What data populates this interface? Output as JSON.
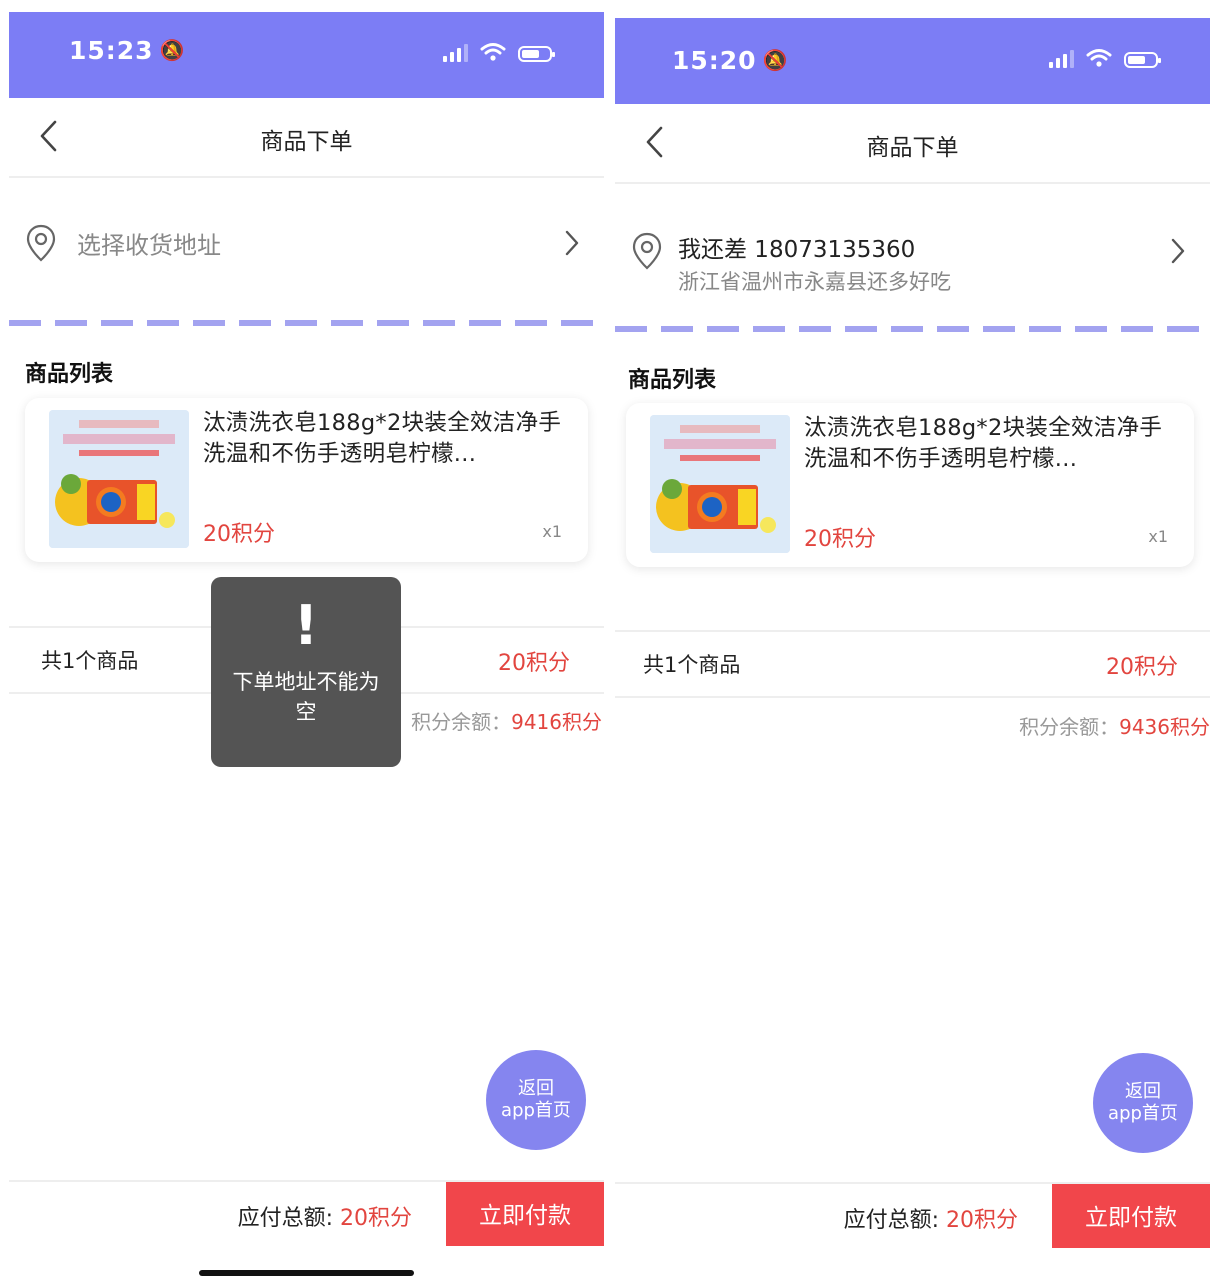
{
  "colors": {
    "accent": "#7c7df5",
    "price": "#e2453f",
    "pay_button": "#f1464b",
    "toast_bg": "#545454"
  },
  "left": {
    "status": {
      "time": "15:23"
    },
    "nav": {
      "title": "商品下单"
    },
    "address": {
      "placeholder": "选择收货地址"
    },
    "section_title": "商品列表",
    "product": {
      "title": "汰渍洗衣皂188g*2块装全效洁净手洗温和不伤手透明皂柠檬...",
      "price": "20积分",
      "qty": "x1"
    },
    "summary": {
      "count": "共1个商品",
      "total": "20积分"
    },
    "balance": {
      "label": "积分余额：",
      "value": "9416积分"
    },
    "home_button": {
      "line1": "返回",
      "line2": "app首页"
    },
    "footer": {
      "total_label": "应付总额: ",
      "total_value": "20积分",
      "pay_label": "立即付款"
    },
    "toast": {
      "icon": "!",
      "message": "下单地址不能为空"
    }
  },
  "right": {
    "status": {
      "time": "15:20"
    },
    "nav": {
      "title": "商品下单"
    },
    "address": {
      "name_phone": "我还差 18073135360",
      "detail": "浙江省温州市永嘉县还多好吃"
    },
    "section_title": "商品列表",
    "product": {
      "title": "汰渍洗衣皂188g*2块装全效洁净手洗温和不伤手透明皂柠檬...",
      "price": "20积分",
      "qty": "x1"
    },
    "summary": {
      "count": "共1个商品",
      "total": "20积分"
    },
    "balance": {
      "label": "积分余额：",
      "value": "9436积分"
    },
    "home_button": {
      "line1": "返回",
      "line2": "app首页"
    },
    "footer": {
      "total_label": "应付总额: ",
      "total_value": "20积分",
      "pay_label": "立即付款"
    }
  }
}
